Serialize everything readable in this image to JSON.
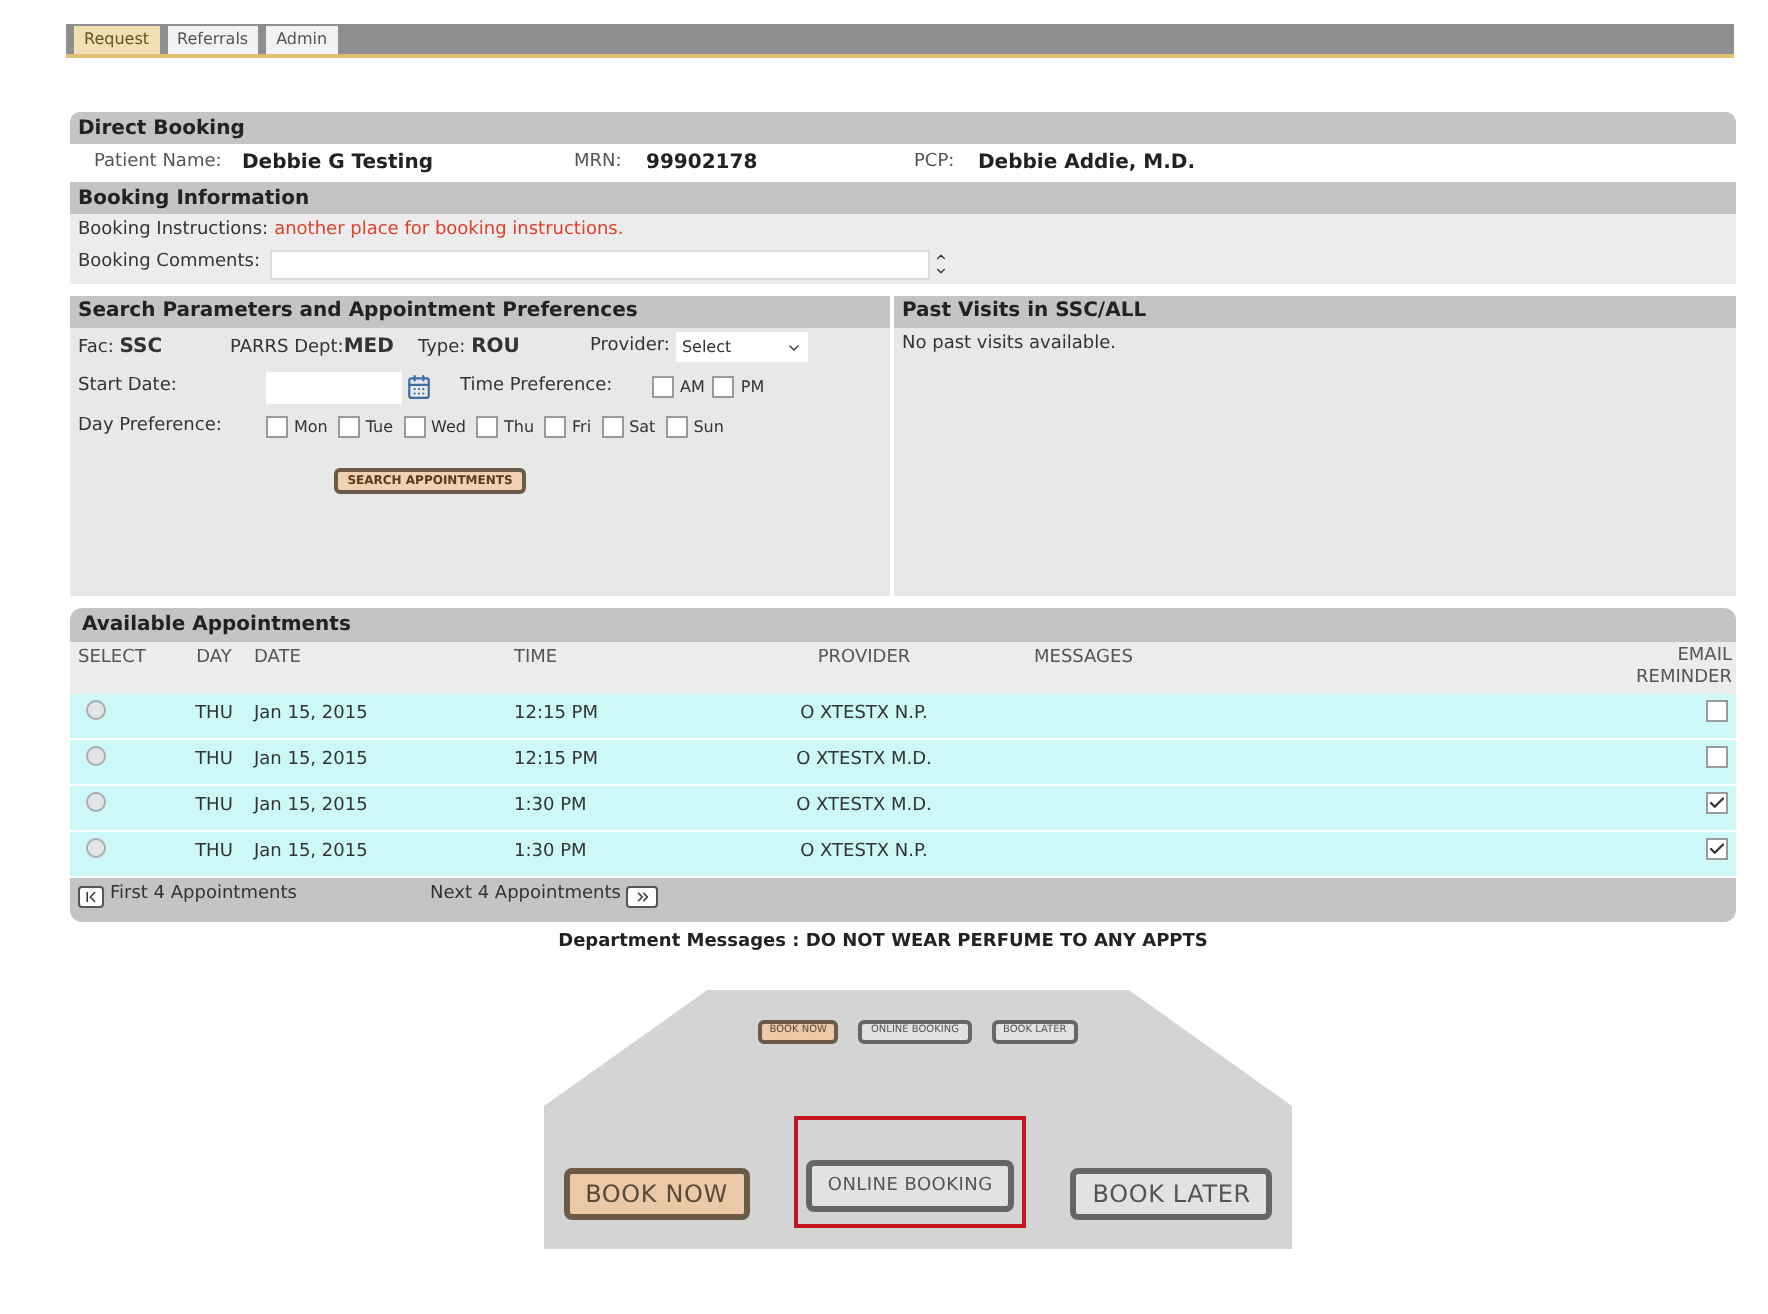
{
  "tabs": [
    {
      "label": "Request",
      "selected": true
    },
    {
      "label": "Referrals",
      "selected": false
    },
    {
      "label": "Admin",
      "selected": false
    }
  ],
  "direct_booking": {
    "title": "Direct Booking",
    "patient_name_label": "Patient Name:",
    "patient_name": "Debbie G Testing",
    "mrn_label": "MRN:",
    "mrn": "99902178",
    "pcp_label": "PCP:",
    "pcp": "Debbie Addie, M.D."
  },
  "booking_information": {
    "title": "Booking Information",
    "instructions_label": "Booking Instructions:",
    "instructions": "another place for booking instructions.",
    "comments_label": "Booking Comments:"
  },
  "search": {
    "title": "Search Parameters and Appointment Preferences",
    "fac_label": "Fac:",
    "fac": "SSC",
    "dept_label": "PARRS Dept:",
    "dept": "MED",
    "type_label": "Type:",
    "type": "ROU",
    "provider_label": "Provider:",
    "provider_value": "Select",
    "start_date_label": "Start Date:",
    "time_pref_label": "Time Preference:",
    "time_options": [
      {
        "label": "AM",
        "checked": false
      },
      {
        "label": "PM",
        "checked": false
      }
    ],
    "day_pref_label": "Day Preference:",
    "days": [
      {
        "label": "Mon",
        "checked": false
      },
      {
        "label": "Tue",
        "checked": false
      },
      {
        "label": "Wed",
        "checked": false
      },
      {
        "label": "Thu",
        "checked": false
      },
      {
        "label": "Fri",
        "checked": false
      },
      {
        "label": "Sat",
        "checked": false
      },
      {
        "label": "Sun",
        "checked": false
      }
    ],
    "search_button": "SEARCH APPOINTMENTS"
  },
  "past_visits": {
    "title": "Past Visits in SSC/ALL",
    "message": "No past visits available."
  },
  "appointments": {
    "title": "Available Appointments",
    "columns": [
      "SELECT",
      "DAY",
      "DATE",
      "TIME",
      "PROVIDER",
      "MESSAGES",
      "EMAIL REMINDER"
    ],
    "rows": [
      {
        "selected": false,
        "day": "THU",
        "date": "Jan 15, 2015",
        "time": "12:15 PM",
        "provider": "O XTESTX N.P.",
        "email_reminder": false
      },
      {
        "selected": false,
        "day": "THU",
        "date": "Jan 15, 2015",
        "time": "12:15 PM",
        "provider": "O XTESTX M.D.",
        "email_reminder": false
      },
      {
        "selected": false,
        "day": "THU",
        "date": "Jan 15, 2015",
        "time": "1:30 PM",
        "provider": "O XTESTX M.D.",
        "email_reminder": true
      },
      {
        "selected": false,
        "day": "THU",
        "date": "Jan 15, 2015",
        "time": "1:30 PM",
        "provider": "O XTESTX N.P.",
        "email_reminder": true
      }
    ],
    "first_label": "First 4 Appointments",
    "next_label": "Next 4 Appointments"
  },
  "department_message": "Department Messages : DO NOT WEAR PERFUME TO ANY APPTS",
  "booking_options": {
    "small_buttons": [
      {
        "label": "BOOK NOW",
        "kind": "primary"
      },
      {
        "label": "ONLINE BOOKING",
        "kind": "secondary"
      },
      {
        "label": "BOOK LATER",
        "kind": "secondary"
      }
    ],
    "large_buttons": [
      {
        "label": "BOOK NOW",
        "kind": "primary",
        "highlighted": false
      },
      {
        "label": "ONLINE BOOKING",
        "kind": "secondary",
        "highlighted": true
      },
      {
        "label": "BOOK LATER",
        "kind": "secondary",
        "highlighted": false
      }
    ]
  }
}
